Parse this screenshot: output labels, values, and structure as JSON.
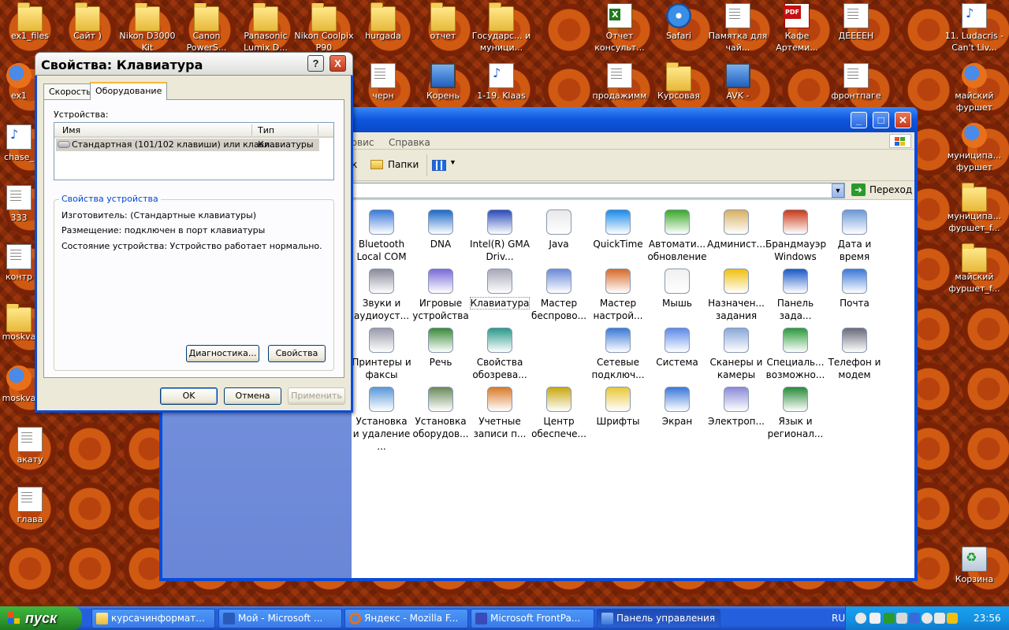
{
  "desktop": {
    "icons": [
      {
        "label": "ex1_files",
        "icon": "folder-icon"
      },
      {
        "label": "Сайт )",
        "icon": "folder-icon"
      },
      {
        "label": "Nikon D3000 Kit",
        "icon": "folder-icon"
      },
      {
        "label": "Canon PowerS...",
        "icon": "folder-icon"
      },
      {
        "label": "Panasonic Lumix D...",
        "icon": "folder-icon"
      },
      {
        "label": "Nikon Coolpix P90",
        "icon": "folder-icon"
      },
      {
        "label": "hurgada",
        "icon": "folder-icon"
      },
      {
        "label": "отчет",
        "icon": "folder-icon"
      },
      {
        "label": "Государс... и муници...",
        "icon": "folder-icon"
      },
      {
        "label": "Отчет консульт...",
        "icon": "excel-file-icon"
      },
      {
        "label": "Safari",
        "icon": "safari-icon"
      },
      {
        "label": "Памятка для чай...",
        "icon": "document-icon"
      },
      {
        "label": "Кафе Артеми...",
        "icon": "pdf-file-icon"
      },
      {
        "label": "ДЕЕЕЕН",
        "icon": "document-icon"
      },
      {
        "label": "11. Ludacris - Can't Liv...",
        "icon": "mp3-file-icon"
      },
      {
        "label": "ex1",
        "icon": "firefox-icon"
      },
      {
        "label": "черн",
        "icon": "image-file-icon"
      },
      {
        "label": "Корень",
        "icon": "computer-icon"
      },
      {
        "label": "1-19. Klaas",
        "icon": "mp3-file-icon"
      },
      {
        "label": "продажимм",
        "icon": "image-file-icon"
      },
      {
        "label": "Курсовая",
        "icon": "folder-icon"
      },
      {
        "label": "AVK -",
        "icon": "network-icon"
      },
      {
        "label": "фронтпаге",
        "icon": "word-file-icon"
      },
      {
        "label": "майский фуршет",
        "icon": "firefox-icon"
      },
      {
        "label": "chase_",
        "icon": "mp3-file-icon"
      },
      {
        "label": "муниципа... фуршет",
        "icon": "firefox-icon"
      },
      {
        "label": "333",
        "icon": "image-file-icon"
      },
      {
        "label": "муниципа... фуршет_f...",
        "icon": "folder-icon"
      },
      {
        "label": "контр",
        "icon": "image-file-icon"
      },
      {
        "label": "майский фуршет_f...",
        "icon": "folder-icon"
      },
      {
        "label": "moskva",
        "icon": "folder-icon"
      },
      {
        "label": "moskva",
        "icon": "firefox-icon"
      },
      {
        "label": "акату",
        "icon": "document-icon"
      },
      {
        "label": "глава",
        "icon": "document-icon"
      },
      {
        "label": "Корзина",
        "icon": "recycle-bin-icon"
      }
    ]
  },
  "control_panel": {
    "menu_visible": [
      "ервис",
      "Справка"
    ],
    "toolbar_folders_label": "Папки",
    "toolbar_partial": "к",
    "go_label": "Переход",
    "items": [
      "Bluetooth Local COM",
      "DNA",
      "Intel(R) GMA Driv...",
      "Java",
      "QuickTime",
      "Автомати... обновление",
      "Админист...",
      "Брандмауэр Windows",
      "Дата и время",
      "Звуки и аудиоуст...",
      "Игровые устройства",
      "Клавиатура",
      "Мастер беспрово...",
      "Мастер настрой...",
      "Мышь",
      "Назначен... задания",
      "Панель зада...",
      "Почта",
      "Принтеры и факсы",
      "Речь",
      "Свойства обозрева...",
      "",
      "Сетевые подключ...",
      "Система",
      "Сканеры и камеры",
      "Специаль... возможно...",
      "Телефон и модем",
      "Установка и удаление ...",
      "Установка оборудов...",
      "Учетные записи п...",
      "Центр обеспече...",
      "Шрифты",
      "Экран",
      "Электроп...",
      "Язык и регионал..."
    ],
    "selected_item": "Клавиатура"
  },
  "dialog": {
    "title": "Свойства: Клавиатура",
    "help_button": "?",
    "close_button": "X",
    "tabs": [
      "Скорость",
      "Оборудование"
    ],
    "active_tab": "Оборудование",
    "devices_label": "Устройства:",
    "columns": [
      "Имя",
      "Тип"
    ],
    "device_rows": [
      {
        "name": "Стандартная (101/102 клавиши) или клави...",
        "type": "Клавиатуры"
      }
    ],
    "group_title": "Свойства устройства",
    "manufacturer": "Изготовитель: (Стандартные клавиатуры)",
    "location": "Размещение: подключен в порт клавиатуры",
    "status": "Состояние устройства: Устройство работает нормально.",
    "diagnostics_button": "Диагностика...",
    "properties_button": "Свойства",
    "ok_button": "OK",
    "cancel_button": "Отмена",
    "apply_button": "Применить"
  },
  "taskbar": {
    "start_label": "пуск",
    "items": [
      {
        "label": "курсачинформат...",
        "icon": "folder-icon"
      },
      {
        "label": "Мой - Microsoft ...",
        "icon": "word-icon"
      },
      {
        "label": "Яндекс - Mozilla F...",
        "icon": "firefox-icon"
      },
      {
        "label": "Microsoft FrontPa...",
        "icon": "frontpage-icon"
      },
      {
        "label": "Панель управления",
        "icon": "control-panel-icon"
      }
    ],
    "language": "RU",
    "clock": "23:56"
  }
}
